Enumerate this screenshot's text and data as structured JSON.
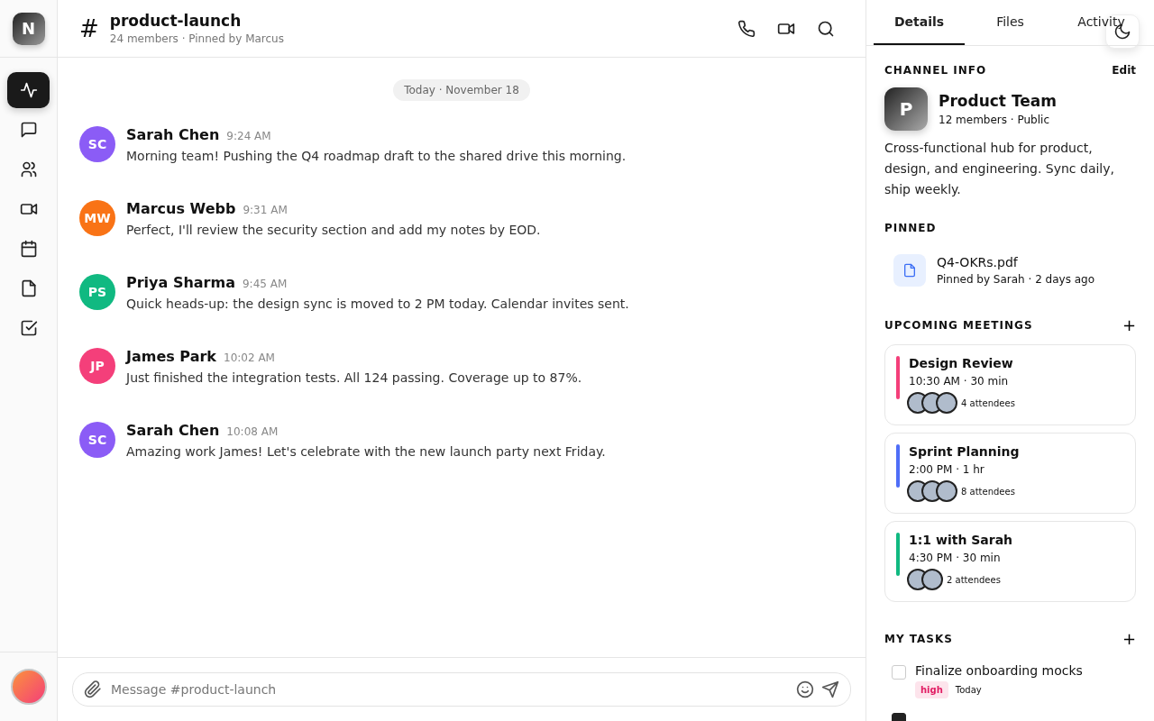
{
  "workspace": {
    "initial": "N"
  },
  "nav": [
    {
      "selected": true
    },
    {
      "selected": false
    },
    {
      "selected": false
    },
    {
      "selected": false
    },
    {
      "selected": false
    },
    {
      "selected": false
    },
    {
      "selected": false
    }
  ],
  "channel": {
    "prefix": "#",
    "name": "product-launch",
    "subtitle": "24 members · Pinned by Marcus"
  },
  "date_divider": "Today · November 18",
  "messages": [
    {
      "initials": "SC",
      "color": "#8b5cf6",
      "author": "Sarah Chen",
      "time": "9:24 AM",
      "text": "Morning team! Pushing the Q4 roadmap draft to the shared drive this morning."
    },
    {
      "initials": "MW",
      "color": "#f97316",
      "author": "Marcus Webb",
      "time": "9:31 AM",
      "text": "Perfect, I'll review the security section and add my notes by EOD."
    },
    {
      "initials": "PS",
      "color": "#10b981",
      "author": "Priya Sharma",
      "time": "9:45 AM",
      "text": "Quick heads-up: the design sync is moved to 2 PM today. Calendar invites sent."
    },
    {
      "initials": "JP",
      "color": "#f43f7a",
      "author": "James Park",
      "time": "10:02 AM",
      "text": "Just finished the integration tests. All 124 passing. Coverage up to 87%."
    },
    {
      "initials": "SC",
      "color": "#8b5cf6",
      "author": "Sarah Chen",
      "time": "10:08 AM",
      "text": "Amazing work James! Let's celebrate with the new launch party next Friday."
    }
  ],
  "composer": {
    "placeholder": "Message #product-launch"
  },
  "tabs": [
    {
      "label": "Details",
      "selected": true
    },
    {
      "label": "Files",
      "selected": false
    },
    {
      "label": "Activity",
      "selected": false
    }
  ],
  "channel_info": {
    "heading": "CHANNEL INFO",
    "edit": "Edit",
    "initial": "P",
    "name": "Product Team",
    "meta": "12 members · Public",
    "description": "Cross-functional hub for product, design, and engineering. Sync daily, ship weekly."
  },
  "pinned": {
    "heading": "PINNED",
    "items": [
      {
        "name": "Q4-OKRs.pdf",
        "meta": "Pinned by Sarah · 2 days ago"
      }
    ]
  },
  "meetings": {
    "heading": "UPCOMING MEETINGS",
    "add": "+",
    "items": [
      {
        "title": "Design Review",
        "time": "10:30 AM · 30 min",
        "attendees": "4 attendees",
        "color": "#f43f7a"
      },
      {
        "title": "Sprint Planning",
        "time": "2:00 PM · 1 hr",
        "attendees": "8 attendees",
        "color": "#4f6ef7"
      },
      {
        "title": "1:1 with Sarah",
        "time": "4:30 PM · 30 min",
        "attendees": "2 attendees",
        "color": "#10b981"
      }
    ]
  },
  "tasks": {
    "heading": "MY TASKS",
    "add": "+",
    "items": [
      {
        "title": "Finalize onboarding mocks",
        "checked": false,
        "priority": "high",
        "due": "Today"
      },
      {
        "checked": true
      }
    ]
  }
}
